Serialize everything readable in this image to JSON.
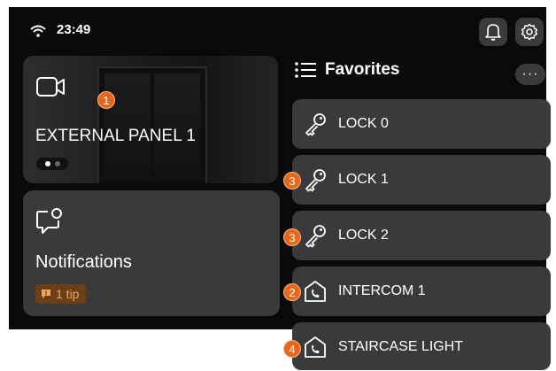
{
  "status": {
    "time": "23:49"
  },
  "camera": {
    "label": "EXTERNAL PANEL 1",
    "badge": "1"
  },
  "notifications": {
    "label": "Notifications",
    "tip": "1 tip"
  },
  "favorites": {
    "title": "Favorites",
    "more": "···",
    "items": [
      {
        "label": "LOCK 0",
        "icon": "key-icon",
        "badge": ""
      },
      {
        "label": "LOCK 1",
        "icon": "key-icon",
        "badge": "3"
      },
      {
        "label": "LOCK 2",
        "icon": "key-icon",
        "badge": "3"
      },
      {
        "label": "INTERCOM 1",
        "icon": "intercom-icon",
        "badge": "2"
      },
      {
        "label": "STAIRCASE LIGHT",
        "icon": "intercom-icon",
        "badge": "4"
      }
    ]
  },
  "colors": {
    "accent": "#e8671c",
    "card": "#3a3a3a",
    "screen": "#0a0a0a"
  }
}
